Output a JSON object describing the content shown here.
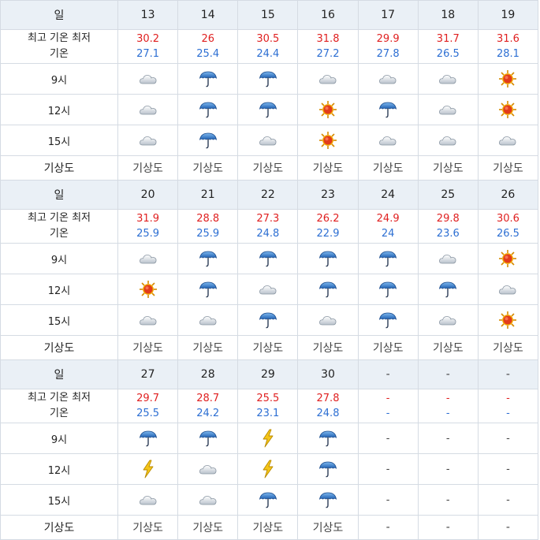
{
  "labels": {
    "day": "일",
    "temp_line1": "최고 기온 최저",
    "temp_line2": "기온",
    "slots": [
      "9시",
      "12시",
      "15시"
    ],
    "forecast": "기상도"
  },
  "blocks": [
    {
      "days": [
        "13",
        "14",
        "15",
        "16",
        "17",
        "18",
        "19"
      ],
      "highs": [
        "30.2",
        "26",
        "30.5",
        "31.8",
        "29.9",
        "31.7",
        "31.6"
      ],
      "lows": [
        "27.1",
        "25.4",
        "24.4",
        "27.2",
        "27.8",
        "26.5",
        "28.1"
      ],
      "weather": [
        [
          "cloud-icon",
          "umbrella-icon",
          "umbrella-icon",
          "cloud-icon",
          "cloud-icon",
          "cloud-icon",
          "sun-icon"
        ],
        [
          "cloud-icon",
          "umbrella-icon",
          "umbrella-icon",
          "sun-icon",
          "umbrella-icon",
          "cloud-icon",
          "sun-icon"
        ],
        [
          "cloud-icon",
          "umbrella-icon",
          "cloud-icon",
          "sun-icon",
          "cloud-icon",
          "cloud-icon",
          "cloud-icon"
        ]
      ],
      "forecast": [
        "기상도",
        "기상도",
        "기상도",
        "기상도",
        "기상도",
        "기상도",
        "기상도"
      ]
    },
    {
      "days": [
        "20",
        "21",
        "22",
        "23",
        "24",
        "25",
        "26"
      ],
      "highs": [
        "31.9",
        "28.8",
        "27.3",
        "26.2",
        "24.9",
        "29.8",
        "30.6"
      ],
      "lows": [
        "25.9",
        "25.9",
        "24.8",
        "22.9",
        "24",
        "23.6",
        "26.5"
      ],
      "weather": [
        [
          "cloud-icon",
          "umbrella-icon",
          "umbrella-icon",
          "umbrella-icon",
          "umbrella-icon",
          "cloud-icon",
          "sun-icon"
        ],
        [
          "sun-icon",
          "umbrella-icon",
          "cloud-icon",
          "umbrella-icon",
          "umbrella-icon",
          "umbrella-icon",
          "cloud-icon"
        ],
        [
          "cloud-icon",
          "cloud-icon",
          "umbrella-icon",
          "cloud-icon",
          "umbrella-icon",
          "cloud-icon",
          "sun-icon"
        ]
      ],
      "forecast": [
        "기상도",
        "기상도",
        "기상도",
        "기상도",
        "기상도",
        "기상도",
        "기상도"
      ]
    },
    {
      "days": [
        "27",
        "28",
        "29",
        "30",
        "-",
        "-",
        "-"
      ],
      "highs": [
        "29.7",
        "28.7",
        "25.5",
        "27.8",
        "-",
        "-",
        "-"
      ],
      "lows": [
        "25.5",
        "24.2",
        "23.1",
        "24.8",
        "-",
        "-",
        "-"
      ],
      "weather": [
        [
          "umbrella-icon",
          "umbrella-icon",
          "lightning-icon",
          "umbrella-icon",
          "-",
          "-",
          "-"
        ],
        [
          "lightning-icon",
          "cloud-icon",
          "lightning-icon",
          "umbrella-icon",
          "-",
          "-",
          "-"
        ],
        [
          "cloud-icon",
          "cloud-icon",
          "umbrella-icon",
          "umbrella-icon",
          "-",
          "-",
          "-"
        ]
      ],
      "forecast": [
        "기상도",
        "기상도",
        "기상도",
        "기상도",
        "-",
        "-",
        "-"
      ]
    }
  ]
}
